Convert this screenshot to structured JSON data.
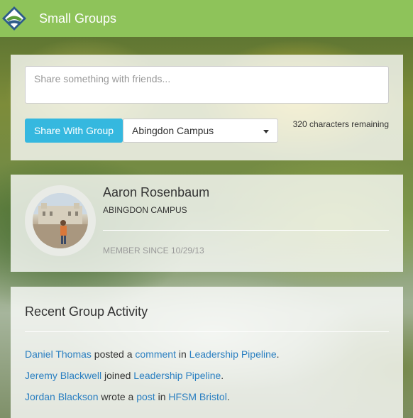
{
  "app": {
    "title": "Small Groups",
    "brand_color": "#8ec35a",
    "accent_color": "#35b8df",
    "link_color": "#2a7fc1"
  },
  "share": {
    "placeholder": "Share something with friends...",
    "button_label": "Share With Group",
    "campus_selected": "Abingdon Campus",
    "chars_remaining": "320 characters remaining"
  },
  "profile": {
    "name": "Aaron Rosenbaum",
    "campus": "ABINGDON CAMPUS",
    "member_since": "MEMBER SINCE 10/29/13"
  },
  "activity": {
    "title": "Recent Group Activity",
    "items": [
      {
        "actor": "Daniel Thomas",
        "verb": " posted a ",
        "object": "comment",
        "prep": " in ",
        "target": "Leadership Pipeline",
        "end": "."
      },
      {
        "actor": "Jeremy Blackwell",
        "verb": " joined ",
        "target": "Leadership Pipeline",
        "end": "."
      },
      {
        "actor": "Jordan Blackson",
        "verb": " wrote a ",
        "object": "post",
        "prep": " in ",
        "target": "HFSM Bristol",
        "end": "."
      }
    ]
  },
  "icons": {
    "logo": "diamond-logo-icon",
    "dropdown": "caret-down-icon"
  }
}
